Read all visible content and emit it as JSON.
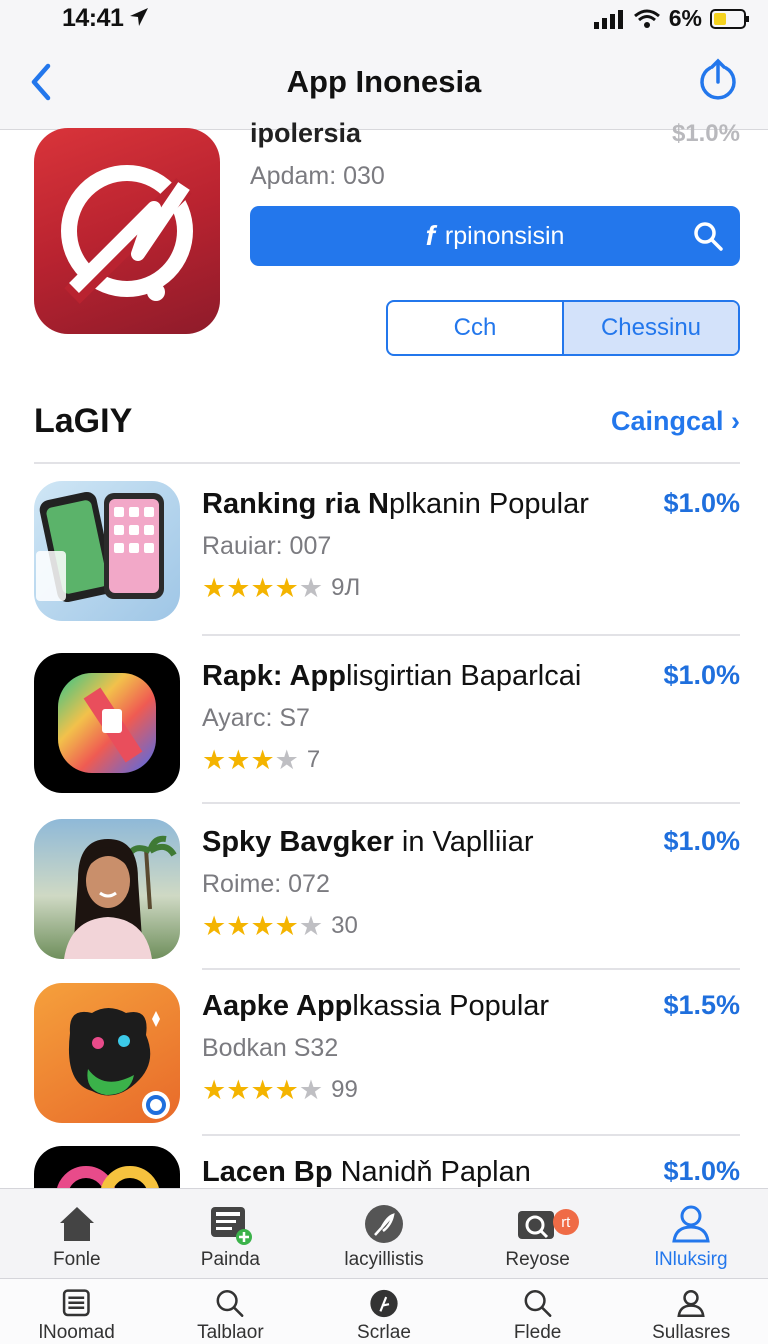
{
  "status": {
    "time": "14:41",
    "battery": "6%"
  },
  "nav": {
    "title": "App Inonesia"
  },
  "hero": {
    "name": "ipolersia",
    "price": "$1.0%",
    "subtitle": "Apdam: 030",
    "search_bolt": "f",
    "search_text": "rpinonsisin",
    "segment": [
      "Cch",
      "Chessinu"
    ]
  },
  "section": {
    "title": "LaGIY",
    "link": "Caingcal ›"
  },
  "items": [
    {
      "title_bold": "Ranking ria N",
      "title_rest": "plkanin Popular",
      "price": "$1.0%",
      "subtitle": "Rauiar: 007",
      "rating": 3.5,
      "count": "9Л"
    },
    {
      "title_bold": "Rapk: App",
      "title_rest": "lisgirtian Baparlcai",
      "price": "$1.0%",
      "subtitle": "Ayarc: S7",
      "rating": 3.5,
      "count": "7"
    },
    {
      "title_bold": "Spky Bavgker",
      "title_rest": " in Vaplliiar",
      "price": "$1.0%",
      "subtitle": "Roime: 072",
      "rating": 3.5,
      "count": "30"
    },
    {
      "title_bold": "Aapke App",
      "title_rest": "lkassia Popular",
      "price": "$1.5%",
      "subtitle": "Bodkan S32",
      "rating": 3.5,
      "count": "99"
    },
    {
      "title_bold": "Lacen Bp",
      "title_rest": "  Nanidň Paplan",
      "price": "$1.0%"
    }
  ],
  "tabs_top": [
    {
      "label": "Fonle",
      "icon": "home-icon"
    },
    {
      "label": "Painda",
      "icon": "news-add-icon"
    },
    {
      "label": "lacyillistis",
      "icon": "feather-icon"
    },
    {
      "label": "Reyose",
      "icon": "camera-search-icon",
      "badge": "rt"
    },
    {
      "label": "lNluksirg",
      "icon": "person-icon"
    }
  ],
  "tabs_bottom": [
    {
      "label": "lNoomad",
      "icon": "list-icon"
    },
    {
      "label": "Talblaor",
      "icon": "search-icon"
    },
    {
      "label": "Scrlae",
      "icon": "feather-icon"
    },
    {
      "label": "Flede",
      "icon": "search-icon"
    },
    {
      "label": "Sullasres",
      "icon": "person-icon"
    }
  ],
  "colors": {
    "accent": "#2377ec",
    "star": "#f4b400",
    "hero_icon": "#c22a34"
  }
}
